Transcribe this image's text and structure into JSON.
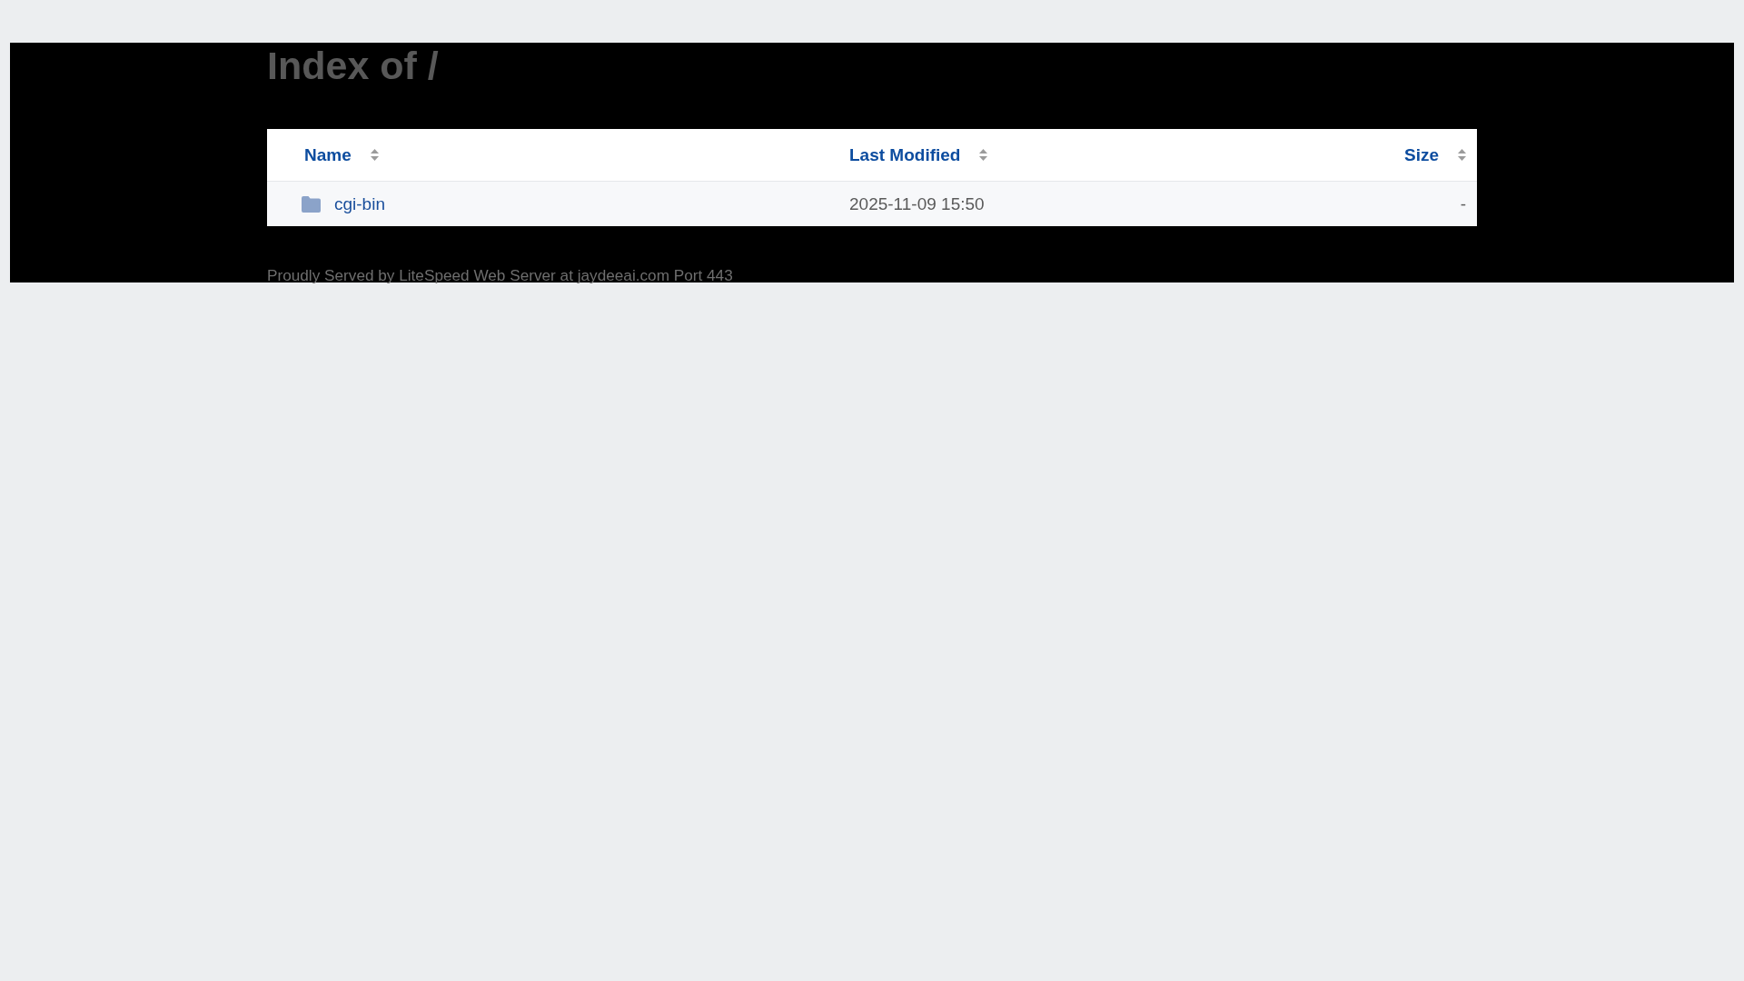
{
  "title": "Index of /",
  "table": {
    "columns": [
      {
        "label": "Name"
      },
      {
        "label": "Last Modified"
      },
      {
        "label": "Size"
      }
    ],
    "rows": [
      {
        "name": "cgi-bin",
        "modified": "2025-11-09 15:50",
        "size": "-"
      }
    ]
  },
  "footer": "Proudly Served by LiteSpeed Web Server at jaydeeai.com Port 443"
}
